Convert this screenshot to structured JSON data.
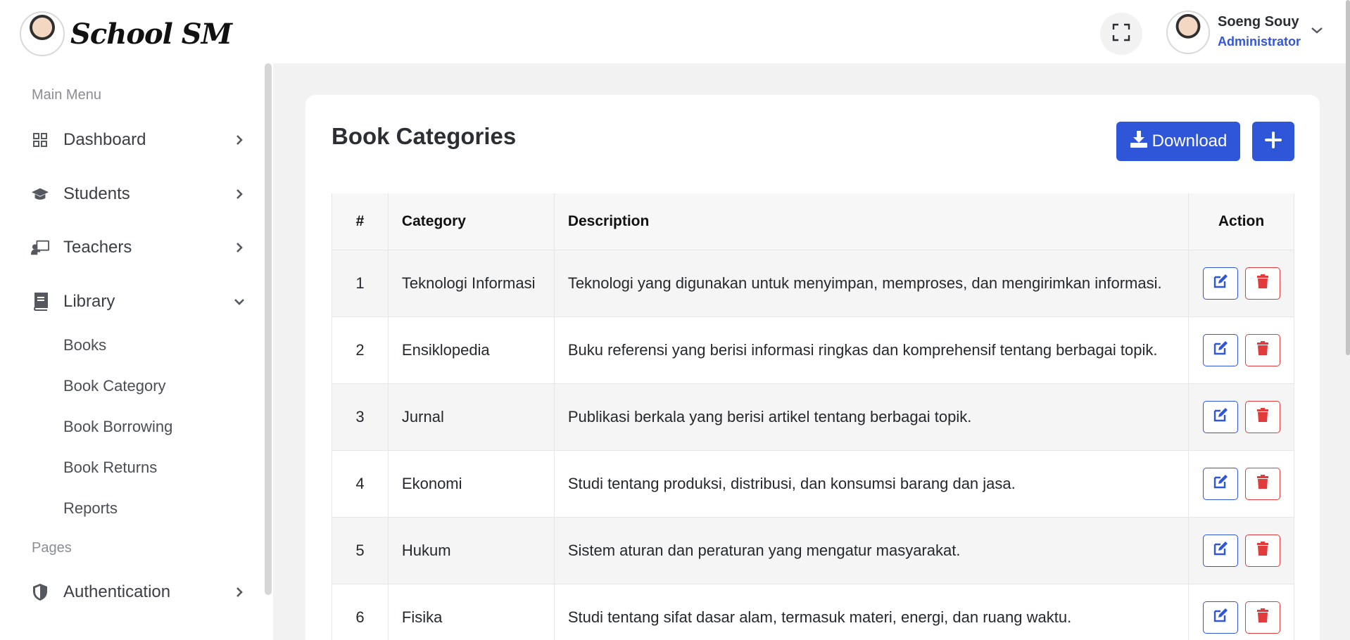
{
  "brand": {
    "name": "School SM"
  },
  "sidebar": {
    "section_main": "Main Menu",
    "section_pages": "Pages",
    "items": [
      {
        "label": "Dashboard",
        "icon": "grid-icon",
        "expanded": false
      },
      {
        "label": "Students",
        "icon": "graduation-cap-icon",
        "expanded": false
      },
      {
        "label": "Teachers",
        "icon": "chalkboard-teacher-icon",
        "expanded": false
      },
      {
        "label": "Library",
        "icon": "book-icon",
        "expanded": true,
        "children": [
          "Books",
          "Book Category",
          "Book Borrowing",
          "Book Returns",
          "Reports"
        ]
      }
    ],
    "pages_items": [
      {
        "label": "Authentication",
        "icon": "shield-icon",
        "expanded": false
      }
    ]
  },
  "header": {
    "user_name": "Soeng Souy",
    "user_role": "Administrator"
  },
  "main": {
    "title": "Book Categories",
    "download_label": "Download",
    "add_icon": "plus-icon"
  },
  "table": {
    "columns": [
      "#",
      "Category",
      "Description",
      "Action"
    ],
    "rows": [
      {
        "num": "1",
        "category": "Teknologi Informasi",
        "description": "Teknologi yang digunakan untuk menyimpan, memproses, dan mengirimkan informasi."
      },
      {
        "num": "2",
        "category": "Ensiklopedia",
        "description": "Buku referensi yang berisi informasi ringkas dan komprehensif tentang berbagai topik."
      },
      {
        "num": "3",
        "category": "Jurnal",
        "description": "Publikasi berkala yang berisi artikel tentang berbagai topik."
      },
      {
        "num": "4",
        "category": "Ekonomi",
        "description": "Studi tentang produksi, distribusi, dan konsumsi barang dan jasa."
      },
      {
        "num": "5",
        "category": "Hukum",
        "description": "Sistem aturan dan peraturan yang mengatur masyarakat."
      },
      {
        "num": "6",
        "category": "Fisika",
        "description": "Studi tentang sifat dasar alam, termasuk materi, energi, dan ruang waktu."
      }
    ]
  },
  "colors": {
    "primary": "#2f55d9",
    "danger": "#e23b3b",
    "role_text": "#3355e0"
  }
}
